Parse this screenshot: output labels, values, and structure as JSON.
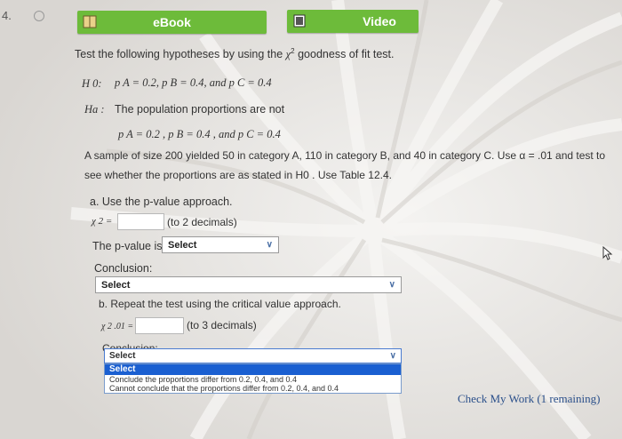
{
  "question": {
    "number": "4."
  },
  "toolbar": {
    "ebook_label": "eBook",
    "video_label": "Video"
  },
  "prompt": {
    "intro_before": "Test the following hypotheses by using the",
    "chi": "χ",
    "sup": "2",
    "intro_after": "goodness of fit test.",
    "h0_label": "H 0:",
    "h0_text": "p A = 0.2, p B = 0.4,  and p C = 0.4",
    "ha_label": "Ha :",
    "ha_text": "The population proportions are not",
    "ha_values": "p A = 0.2 , p B = 0.4 , and p C = 0.4",
    "sample_line1": "A sample of size 200 yielded 50 in category A, 110 in category B, and 40 in category C. Use α = .01 and test to",
    "sample_line2": "see whether the proportions are as stated in H0 . Use Table 12.4."
  },
  "part_a": {
    "label": "a.  Use the p-value approach.",
    "chi_label": "χ 2 =",
    "hint": "(to 2 decimals)",
    "pvalue_text": "The p-value is",
    "pvalue_select": "Select",
    "conclusion_label": "Conclusion:",
    "conclusion_select": "Select"
  },
  "part_b": {
    "label": "b.  Repeat the test using the critical value approach.",
    "chi_label": "χ 2 .01 =",
    "hint": "(to 3 decimals)",
    "conclusion_label": "Conclusion:",
    "dropdown_value": "Select",
    "options": [
      "Select",
      "Conclude the proportions differ from 0.2, 0.4, and 0.4",
      "Cannot conclude that the proportions differ from 0.2, 0.4, and 0.4"
    ]
  },
  "footer": {
    "check_work": "Check My Work (1 remaining)"
  },
  "colors": {
    "green_button": "#6dbb3a",
    "highlight": "#1a5fd1",
    "link": "#2a4f8a"
  }
}
